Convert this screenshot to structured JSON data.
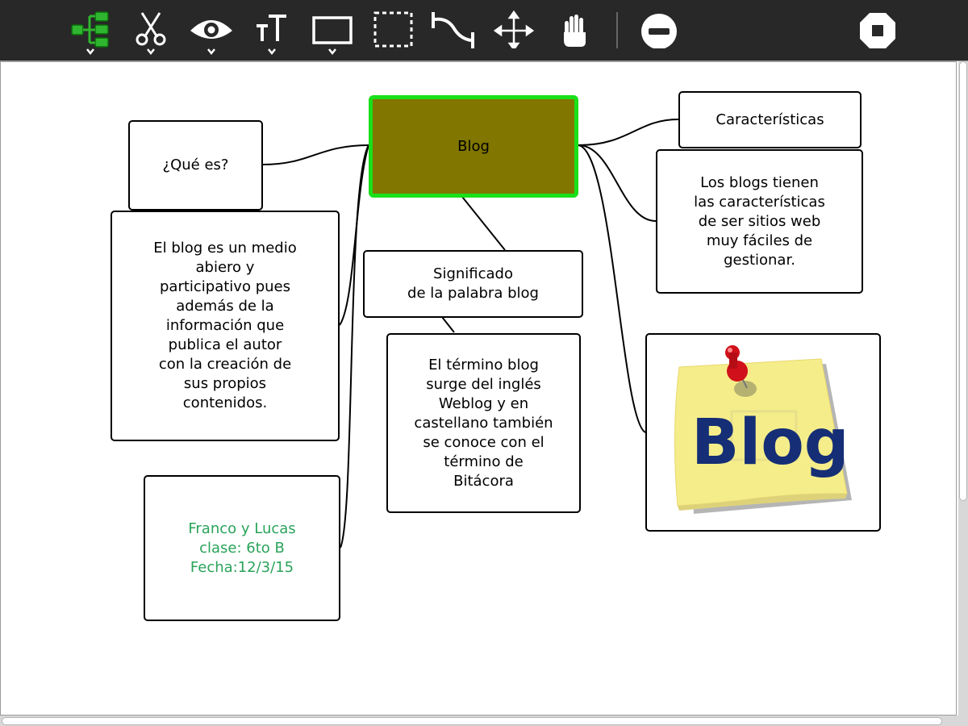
{
  "toolbar": {
    "tools": [
      {
        "id": "tree",
        "name": "mind-map-tree-icon",
        "has_menu": true,
        "active": true
      },
      {
        "id": "cut",
        "name": "scissors-icon",
        "has_menu": true
      },
      {
        "id": "view",
        "name": "eye-icon",
        "has_menu": true
      },
      {
        "id": "text",
        "name": "text-size-icon",
        "has_menu": true
      },
      {
        "id": "shape",
        "name": "rectangle-icon",
        "has_menu": true
      },
      {
        "id": "select",
        "name": "selection-icon",
        "has_menu": false
      },
      {
        "id": "link",
        "name": "connector-icon",
        "has_menu": false
      },
      {
        "id": "move",
        "name": "move-arrows-icon",
        "has_menu": false
      },
      {
        "id": "pan",
        "name": "hand-icon",
        "has_menu": false
      },
      {
        "id": "remove",
        "name": "minus-circle-icon",
        "has_menu": false
      },
      {
        "id": "stop",
        "name": "stop-icon",
        "has_menu": false
      }
    ]
  },
  "colors": {
    "toolbar_bg": "#282828",
    "root_fill": "#807600",
    "root_border": "#19e019",
    "credits_text": "#2aa35a",
    "accent_green": "#19e019"
  },
  "mindmap": {
    "root": {
      "text": "Blog"
    },
    "nodes": {
      "que_es": "¿Qué es?",
      "que_es_desc": "El blog es un medio\nabiero  y\nparticipativo pues\nademás de la\ninformación que\npublica el autor\ncon la creación de\nsus propios\ncontenidos.",
      "credits": "Franco y Lucas\nclase: 6to B\nFecha:12/3/15",
      "significado": "Significado\nde la palabra blog",
      "significado_desc": "El término blog\nsurge del inglés\nWeblog y en\ncastellano también\nse conoce con el\ntérmino de\nBitácora",
      "caracteristicas": "Características",
      "caracteristicas_desc": "Los blogs tienen\nlas características\nde ser sitios web\nmuy fáciles de\ngestionar."
    },
    "image_node": {
      "sticky_text": "Blog",
      "icon": "pushpin-sticky-note-icon"
    }
  }
}
